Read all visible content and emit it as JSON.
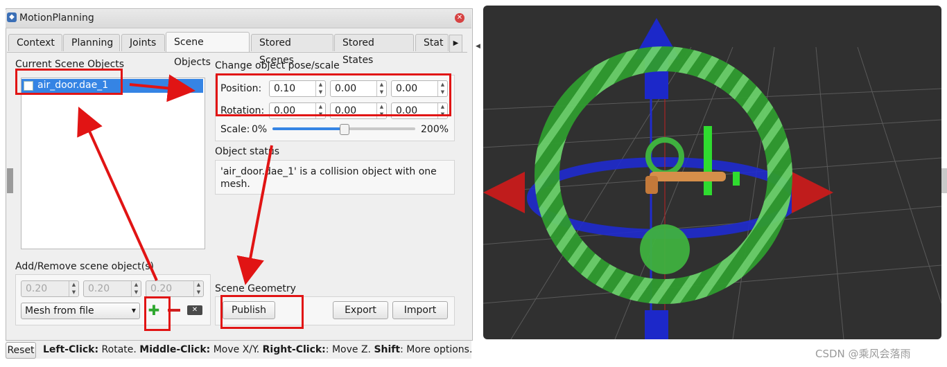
{
  "window": {
    "title": "MotionPlanning"
  },
  "tabs": [
    {
      "label": "Context"
    },
    {
      "label": "Planning"
    },
    {
      "label": "Joints"
    },
    {
      "label": "Scene Objects"
    },
    {
      "label": "Stored Scenes"
    },
    {
      "label": "Stored States"
    },
    {
      "label": "Stat"
    }
  ],
  "scene_objects": {
    "group_label": "Current Scene Objects",
    "items": [
      {
        "label": "air_door.dae_1",
        "checked": false,
        "selected": true
      }
    ]
  },
  "pose": {
    "group_label": "Change object pose/scale",
    "position_label": "Position:",
    "position": [
      "0.10",
      "0.00",
      "0.00"
    ],
    "rotation_label": "Rotation:",
    "rotation": [
      "0.00",
      "0.00",
      "0.00"
    ],
    "scale_label": "Scale:",
    "scale_min": "0%",
    "scale_max": "200%",
    "scale_value_fraction": 0.5
  },
  "object_status": {
    "group_label": "Object status",
    "text": "'air_door.dae_1' is a collision object with one mesh."
  },
  "add_remove": {
    "group_label": "Add/Remove scene object(s)",
    "dims": [
      "0.20",
      "0.20",
      "0.20"
    ],
    "shape_select": "Mesh from file"
  },
  "scene_geometry": {
    "group_label": "Scene Geometry",
    "publish": "Publish",
    "export": "Export",
    "import": "Import"
  },
  "statusbar": {
    "reset": "Reset",
    "hint_parts": [
      {
        "bold": "Left-Click:",
        "text": " Rotate. "
      },
      {
        "bold": "Middle-Click:",
        "text": " Move X/Y. "
      },
      {
        "bold": "Right-Click:",
        "text": ": Move Z. "
      },
      {
        "bold": "Shift",
        "text": ": More options."
      }
    ]
  },
  "watermark": "CSDN @乘风会落雨",
  "colors": {
    "selection": "#3584e4",
    "annotation": "#e11414",
    "viewport_bg": "#303030"
  }
}
